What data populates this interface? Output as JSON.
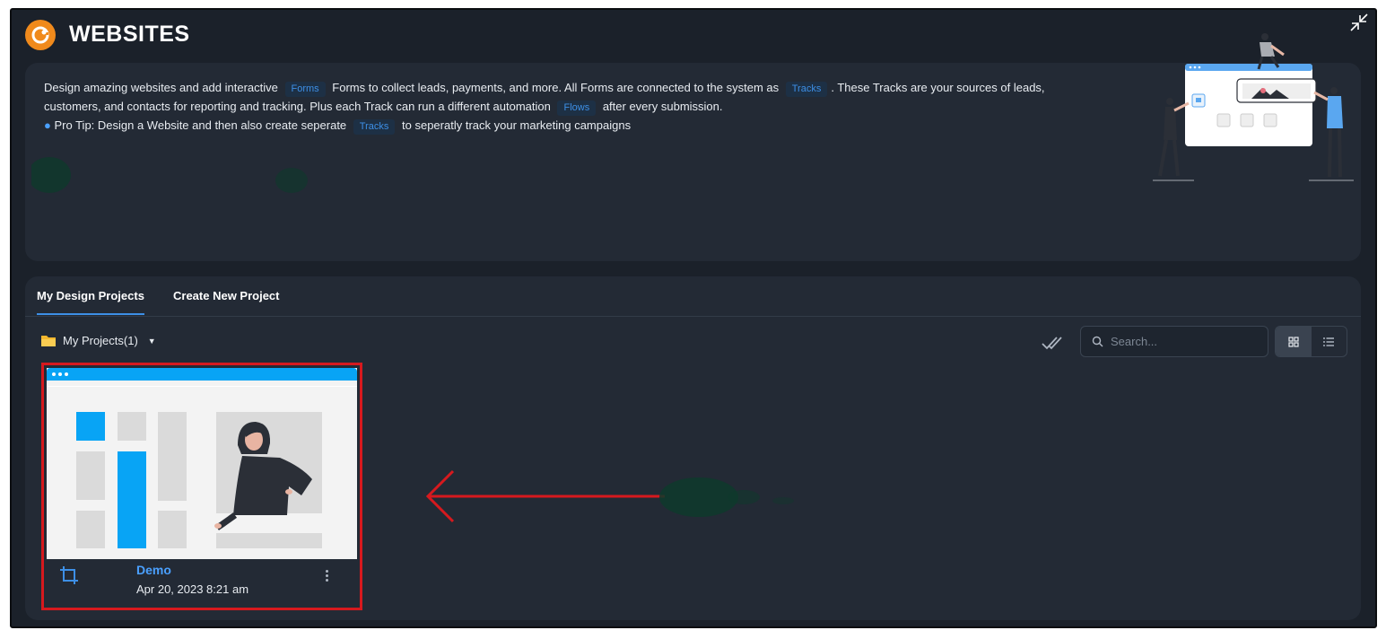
{
  "app": {
    "title": "WEBSITES",
    "logo_icon": "orange-logo-icon"
  },
  "banner": {
    "line1_before": "Design amazing websites and add interactive",
    "line1_pill1": "Forms",
    "line1_middle": "Forms to collect leads, payments, and more. All Forms are connected to the system as",
    "line1_pill2": "Tracks",
    "line1_after": ". These Tracks are your sources of leads,",
    "line2_before": "customers, and contacts for reporting and tracking. Plus each Track can run a different automation",
    "line2_pill": "Flows",
    "line2_after": "after every submission.",
    "line3_before": "Pro Tip: Design a Website and then also create seperate",
    "line3_pill": "Tracks",
    "line3_after": "to seperatly track your marketing campaigns"
  },
  "tabs": [
    {
      "label": "My Design Projects",
      "active": true
    },
    {
      "label": "Create New Project",
      "active": false
    }
  ],
  "folder": {
    "label": "My Projects(1)",
    "icon": "folder-icon"
  },
  "search": {
    "placeholder": "Search..."
  },
  "projects": [
    {
      "name": "Demo",
      "date": "Apr 20, 2023 8:21 am"
    }
  ],
  "colors": {
    "accent": "#3d8fe6",
    "background": "#1b212a",
    "panel": "#232a35",
    "highlight": "#d6191e",
    "logo": "#f08a1c"
  }
}
